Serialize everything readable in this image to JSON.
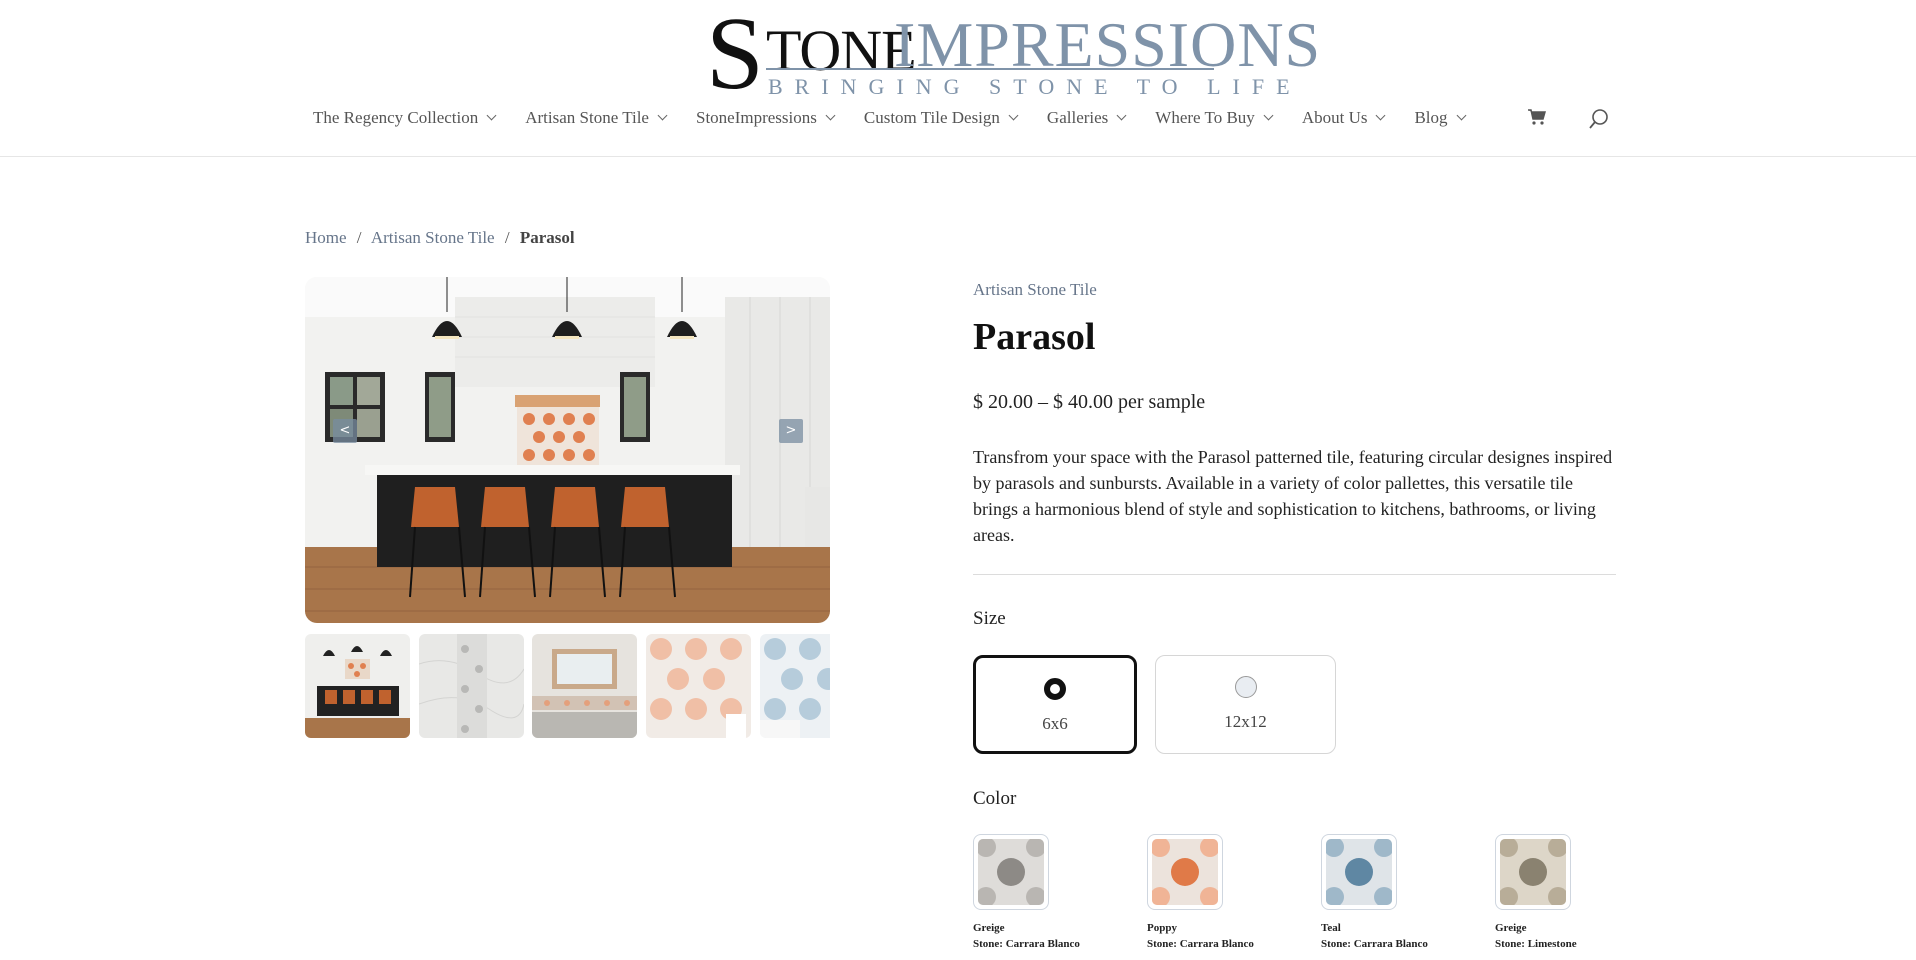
{
  "logo": {
    "first_letter": "S",
    "word_tone": "TONE",
    "word_impressions": "IMPRESSIONS",
    "tagline": "BRINGING STONE TO LIFE"
  },
  "nav": {
    "items": [
      {
        "label": "The Regency Collection"
      },
      {
        "label": "Artisan Stone Tile"
      },
      {
        "label": "StoneImpressions"
      },
      {
        "label": "Custom Tile Design"
      },
      {
        "label": "Galleries"
      },
      {
        "label": "Where To Buy"
      },
      {
        "label": "About Us"
      },
      {
        "label": "Blog"
      }
    ],
    "cart_icon": "cart-icon",
    "search_icon": "search-icon"
  },
  "breadcrumb": {
    "home": "Home",
    "category": "Artisan Stone Tile",
    "current": "Parasol",
    "separator": "/"
  },
  "gallery": {
    "prev_label": "<",
    "next_label": ">",
    "thumbnail_count": 5
  },
  "product": {
    "category": "Artisan Stone Tile",
    "title": "Parasol",
    "price": "$ 20.00 – $ 40.00 per sample",
    "description": "Transfrom your space with the Parasol patterned tile, featuring circular designes inspired by parasols and sunbursts. Available in a variety of color pallettes, this versatile tile brings a harmonious blend of style and sophistication to kitchens, bathrooms, or living areas."
  },
  "size": {
    "label": "Size",
    "options": [
      {
        "label": "6x6",
        "selected": true
      },
      {
        "label": "12x12",
        "selected": false
      }
    ]
  },
  "color": {
    "label": "Color",
    "options": [
      {
        "name": "Greige",
        "stone": "Stone: Carrara Blanco",
        "accent": "#8d8a86"
      },
      {
        "name": "Poppy",
        "stone": "Stone: Carrara Blanco",
        "accent": "#e07a48"
      },
      {
        "name": "Teal",
        "stone": "Stone: Carrara Blanco",
        "accent": "#5f87a3"
      },
      {
        "name": "Greige",
        "stone": "Stone: Limestone",
        "accent": "#8a8270"
      }
    ]
  },
  "colors": {
    "accent": "#7f93a9",
    "link": "#66758a",
    "text": "#222222"
  }
}
